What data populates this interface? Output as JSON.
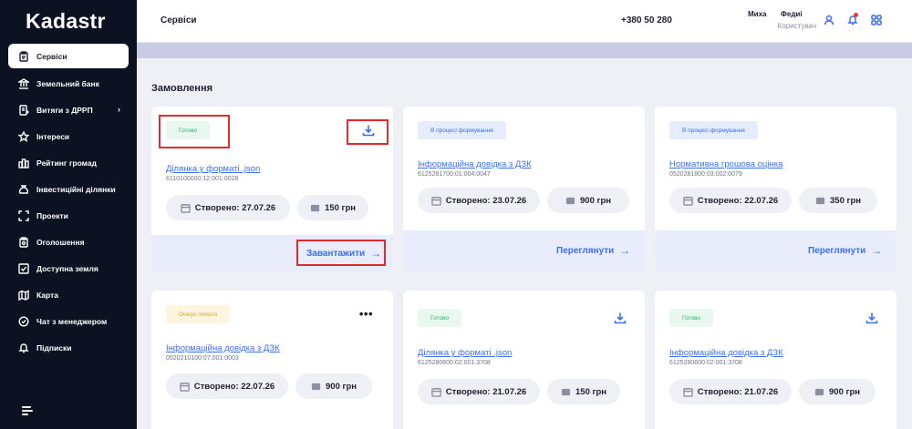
{
  "app": {
    "logo": "Kadastr"
  },
  "sidebar": {
    "items": [
      {
        "label": "Сервіси",
        "icon": "clipboard-icon",
        "active": true
      },
      {
        "label": "Земельний банк",
        "icon": "bank-icon"
      },
      {
        "label": "Витяги з ДРРП",
        "icon": "document-icon",
        "has_chevron": true
      },
      {
        "label": "Інтереси",
        "icon": "star-icon"
      },
      {
        "label": "Рейтинг громад",
        "icon": "city-icon"
      },
      {
        "label": "Інвестиційні ділянки",
        "icon": "money-bag-icon"
      },
      {
        "label": "Проекти",
        "icon": "frame-icon"
      },
      {
        "label": "Оголошення",
        "icon": "notice-icon"
      },
      {
        "label": "Доступна земля",
        "icon": "check-square-icon"
      },
      {
        "label": "Карта",
        "icon": "map-icon"
      },
      {
        "label": "Чат з менеджером",
        "icon": "chat-icon"
      },
      {
        "label": "Підписки",
        "icon": "bell-icon"
      }
    ],
    "chevron": "›"
  },
  "header": {
    "title": "Сервіси",
    "phone": "+380 50 280",
    "user_name": "Миха       Федиі",
    "user_role": "Користувач"
  },
  "main": {
    "section_title": "Замовлення",
    "cards": [
      {
        "status": "Готово",
        "status_color": "#2fb36b",
        "title": "Ділянка у форматі .json",
        "cadastral": "6110100000:12:001:0028",
        "created": "Створено: 27.07.26",
        "price": "150 грн",
        "footer_action": "Завантажити",
        "arrow": "→"
      },
      {
        "status": "В процесі формування",
        "status_color": "#3b6ef6",
        "title": "Інформаційна довідка з ДЗК",
        "cadastral": "6125281700:01:004:0047",
        "created": "Створено: 23.07.26",
        "price": "900 грн",
        "footer_action": "Переглянути",
        "arrow": "→"
      },
      {
        "status": "В процесі формування",
        "status_color": "#3b6ef6",
        "title": "Нормативна грошова оцінка",
        "cadastral": "0520281800:03:002:0079",
        "created": "Створено: 22.07.26",
        "price": "350 грн",
        "footer_action": "Переглянути",
        "arrow": "→"
      },
      {
        "status": "Очікує оплати",
        "status_color": "#d9a52b",
        "title": "Інформаційна довідка з ДЗК",
        "cadastral": "0520210100:07:001:0003",
        "created": "Створено: 22.07.26",
        "price": "900 грн",
        "menu": "•••"
      },
      {
        "status": "Готово",
        "status_color": "#2fb36b",
        "title": "Ділянка у форматі .json",
        "cadastral": "6125280600:02:001:3708",
        "created": "Створено: 21.07.26",
        "price": "150 грн"
      },
      {
        "status": "Готово",
        "status_color": "#2fb36b",
        "title": "Інформаційна довідка з ДЗК",
        "cadastral": "6125280600:02:001:3708",
        "created": "Створено: 21.07.26",
        "price": "900 грн"
      }
    ]
  },
  "colors": {
    "accent": "#3b6ef6",
    "sidebar_bg": "#0c1222",
    "highlight": "#e02b2b"
  }
}
